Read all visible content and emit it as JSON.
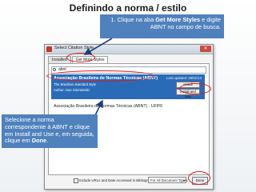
{
  "slide": {
    "title": "Definindo a norma / estilo"
  },
  "dialog": {
    "title": "Select Citation Style",
    "close_label": "✕",
    "tabs": [
      {
        "label": "Installed"
      },
      {
        "label": "Get More Styles"
      }
    ],
    "search": {
      "value": "abnt"
    },
    "selected_result": {
      "title": "Associação Brasileira de Normas Técnicas (ABNT)",
      "line1": "The Brazilian standard style",
      "line2": "Author: Sue Siemienski",
      "updated": "Last updated: 29/01/13",
      "install_label": "Install",
      "install_use_label": "Install and Use"
    },
    "other_result": {
      "title": "Associação Brasileira de Normas Técnicas (ABNT) - UFPR"
    },
    "footer": {
      "checkbox_label": "Include URLs and Date Accessed in Bibliographies:",
      "select_value": "For All Document Types",
      "done_label": "Done"
    }
  },
  "callouts": {
    "top": {
      "p1": "1. Clique na aba ",
      "b1": "Get More Styles",
      "p2": " e digite ABNT no campo de busca."
    },
    "bottom": {
      "p1": "Selecione a norma correspondente à ABNT e clique em Install and Use e, em seguida, clique em ",
      "b1": "Done",
      "p2": "."
    }
  },
  "colors": {
    "callout_bg": "#4f81bd",
    "highlight": "#d62020",
    "selection": "#2a6bb8"
  }
}
